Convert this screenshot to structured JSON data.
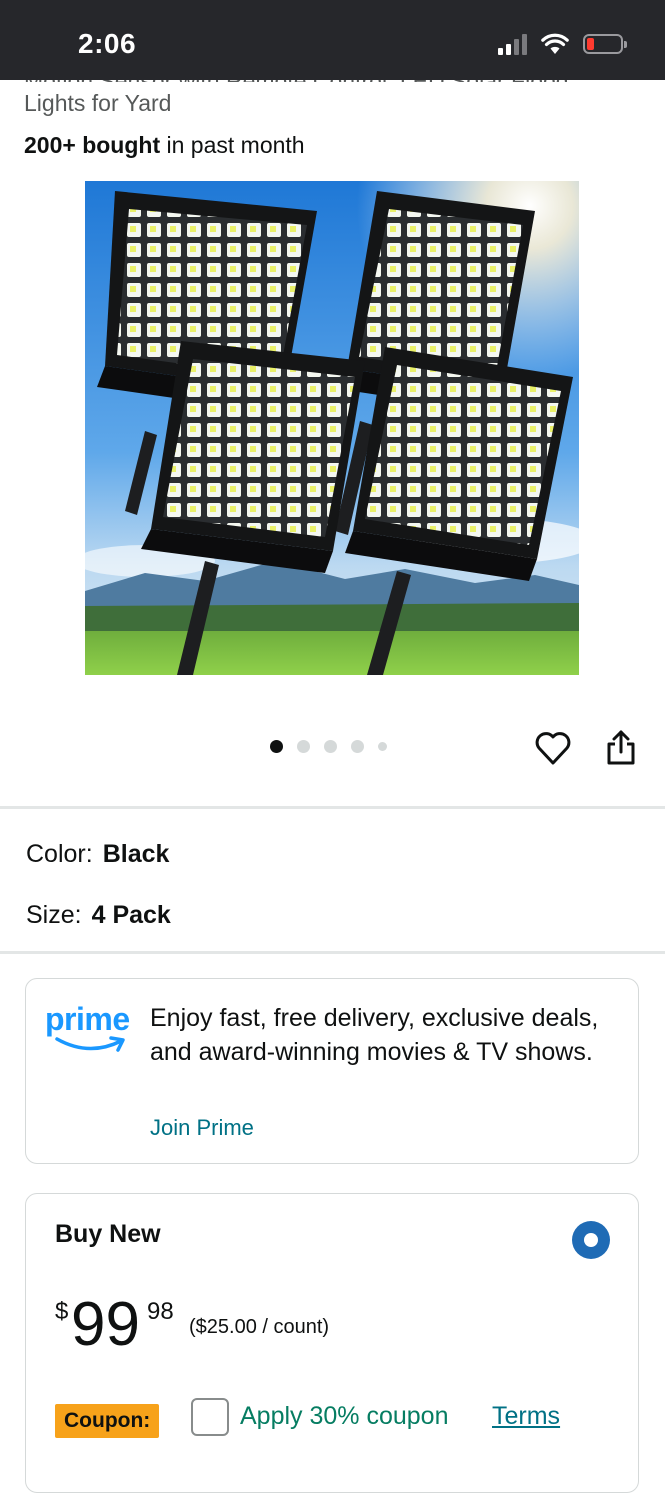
{
  "status_bar": {
    "time": "2:06"
  },
  "product": {
    "title_partial_top": "Motion Sensor with Remote Control, LED Solar Flood",
    "title_partial_bottom": "Lights for Yard",
    "bought_bold": "200+ bought",
    "bought_rest": " in past month",
    "image_indicator": {
      "count": 5,
      "active_index": 0
    }
  },
  "variations": {
    "color_label": "Color:",
    "color_value": "Black",
    "size_label": "Size:",
    "size_value": "4 Pack"
  },
  "prime": {
    "logo_text": "prime",
    "message": "Enjoy fast, free delivery, exclusive deals, and award-winning movies & TV shows.",
    "link": "Join Prime"
  },
  "buy_box": {
    "title": "Buy New",
    "price_symbol": "$",
    "price_whole": "99",
    "price_fraction": "98",
    "unit_price": "($25.00 / count)",
    "coupon_badge": "Coupon:",
    "coupon_apply": "Apply 30% coupon",
    "coupon_terms": "Terms"
  },
  "colors": {
    "status_bar_bg": "#26272b",
    "prime_blue": "#1a98ff",
    "link_teal": "#007185",
    "coupon_green": "#067d62",
    "coupon_badge_orange": "#f7a21a",
    "radio_blue": "#1f6bb5"
  }
}
